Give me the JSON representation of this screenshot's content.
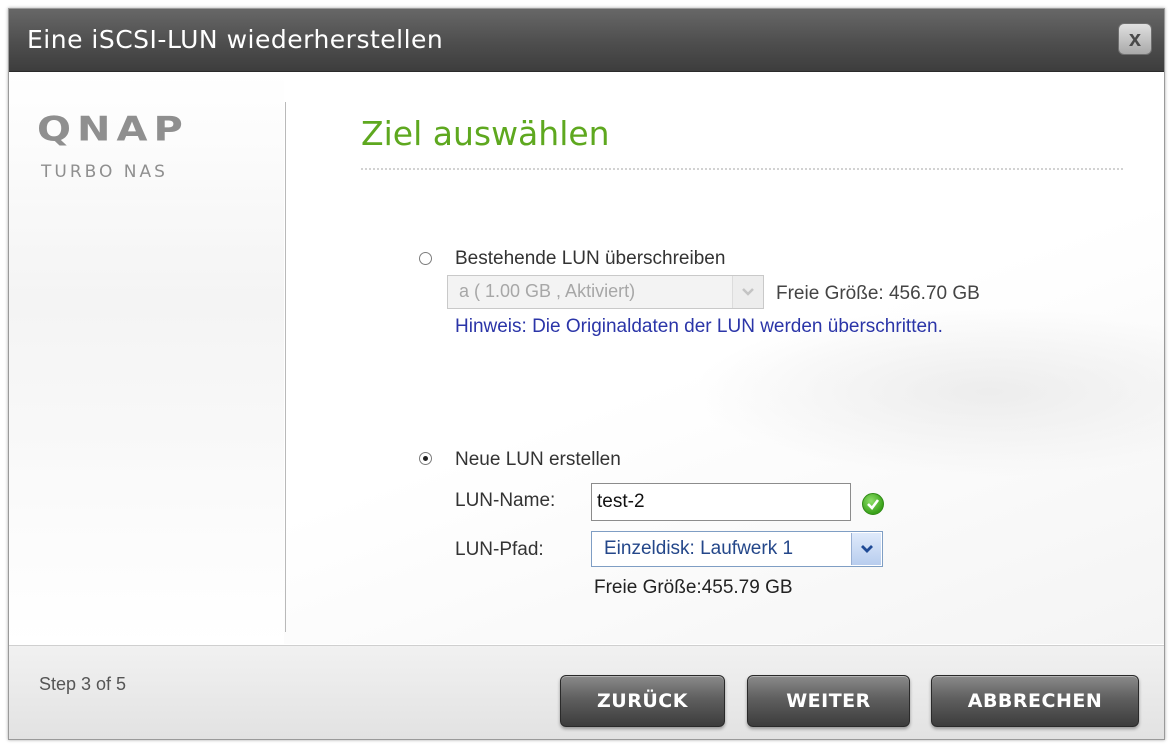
{
  "window": {
    "title": "Eine iSCSI-LUN wiederherstellen",
    "close_label": "x"
  },
  "branding": {
    "logo": "QNAP",
    "tagline": "TURBO NAS"
  },
  "page": {
    "title": "Ziel auswählen"
  },
  "option_overwrite": {
    "label": "Bestehende LUN überschreiben",
    "selected": false,
    "lun_select_value": "a ( 1.00 GB , Aktiviert)",
    "free_size": "Freie Größe: 456.70 GB",
    "hint": "Hinweis: Die Originaldaten der LUN werden überschritten."
  },
  "option_new": {
    "label": "Neue LUN erstellen",
    "selected": true,
    "name_label": "LUN-Name:",
    "name_value": "test-2",
    "path_label": "LUN-Pfad:",
    "path_value": "Einzeldisk: Laufwerk 1",
    "free_size": "Freie Größe:455.79 GB"
  },
  "footer": {
    "step": "Step 3 of 5",
    "back_label": "ZURÜCK",
    "next_label": "WEITER",
    "cancel_label": "ABBRECHEN"
  },
  "colors": {
    "title_green": "#5ea81f",
    "hint_blue": "#2b35a8",
    "titlebar": "#4e4e4e"
  },
  "icons": {
    "close": "close-icon",
    "dropdown": "chevron-down-icon",
    "valid": "check-circle-icon"
  }
}
